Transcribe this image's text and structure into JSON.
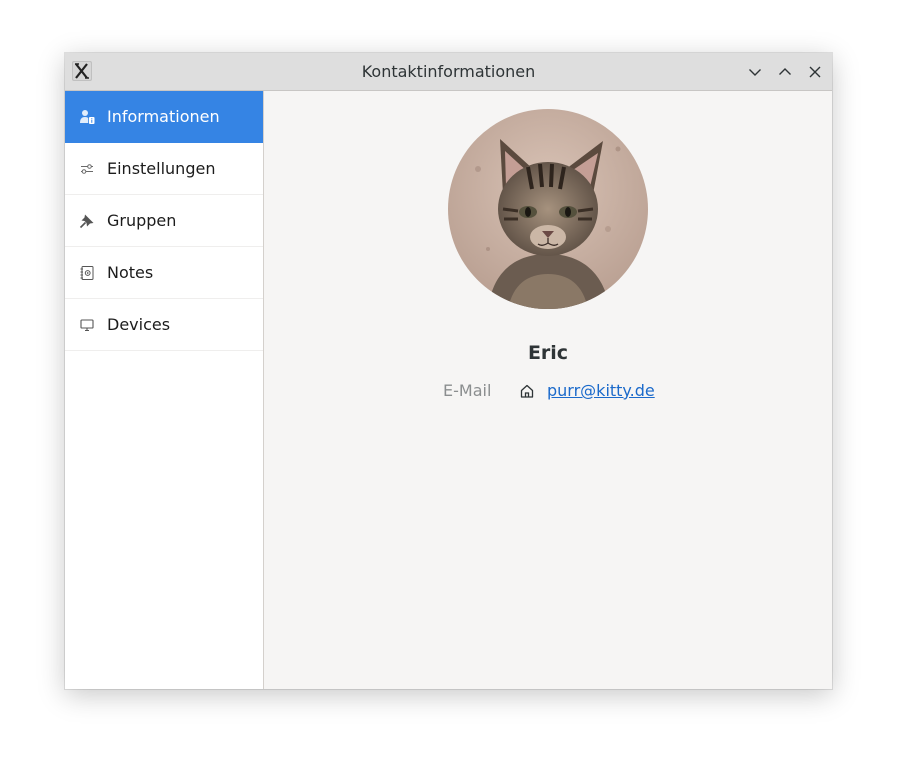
{
  "window": {
    "title": "Kontaktinformationen",
    "app_icon": "x-app-icon",
    "controls": [
      "minimize-icon",
      "maximize-icon",
      "close-icon"
    ]
  },
  "sidebar": {
    "items": [
      {
        "label": "Informationen",
        "icon": "contact-info-icon",
        "active": true
      },
      {
        "label": "Einstellungen",
        "icon": "sliders-icon",
        "active": false
      },
      {
        "label": "Gruppen",
        "icon": "pin-icon",
        "active": false
      },
      {
        "label": "Notes",
        "icon": "notebook-icon",
        "active": false
      },
      {
        "label": "Devices",
        "icon": "monitor-icon",
        "active": false
      }
    ]
  },
  "contact": {
    "name": "Eric",
    "email_label": "E-Mail",
    "email_type_icon": "home-icon",
    "email": "purr@kitty.de"
  },
  "colors": {
    "accent": "#3584e4",
    "link": "#1b6acb",
    "titlebar": "#dedede",
    "content_bg": "#f6f5f4"
  }
}
